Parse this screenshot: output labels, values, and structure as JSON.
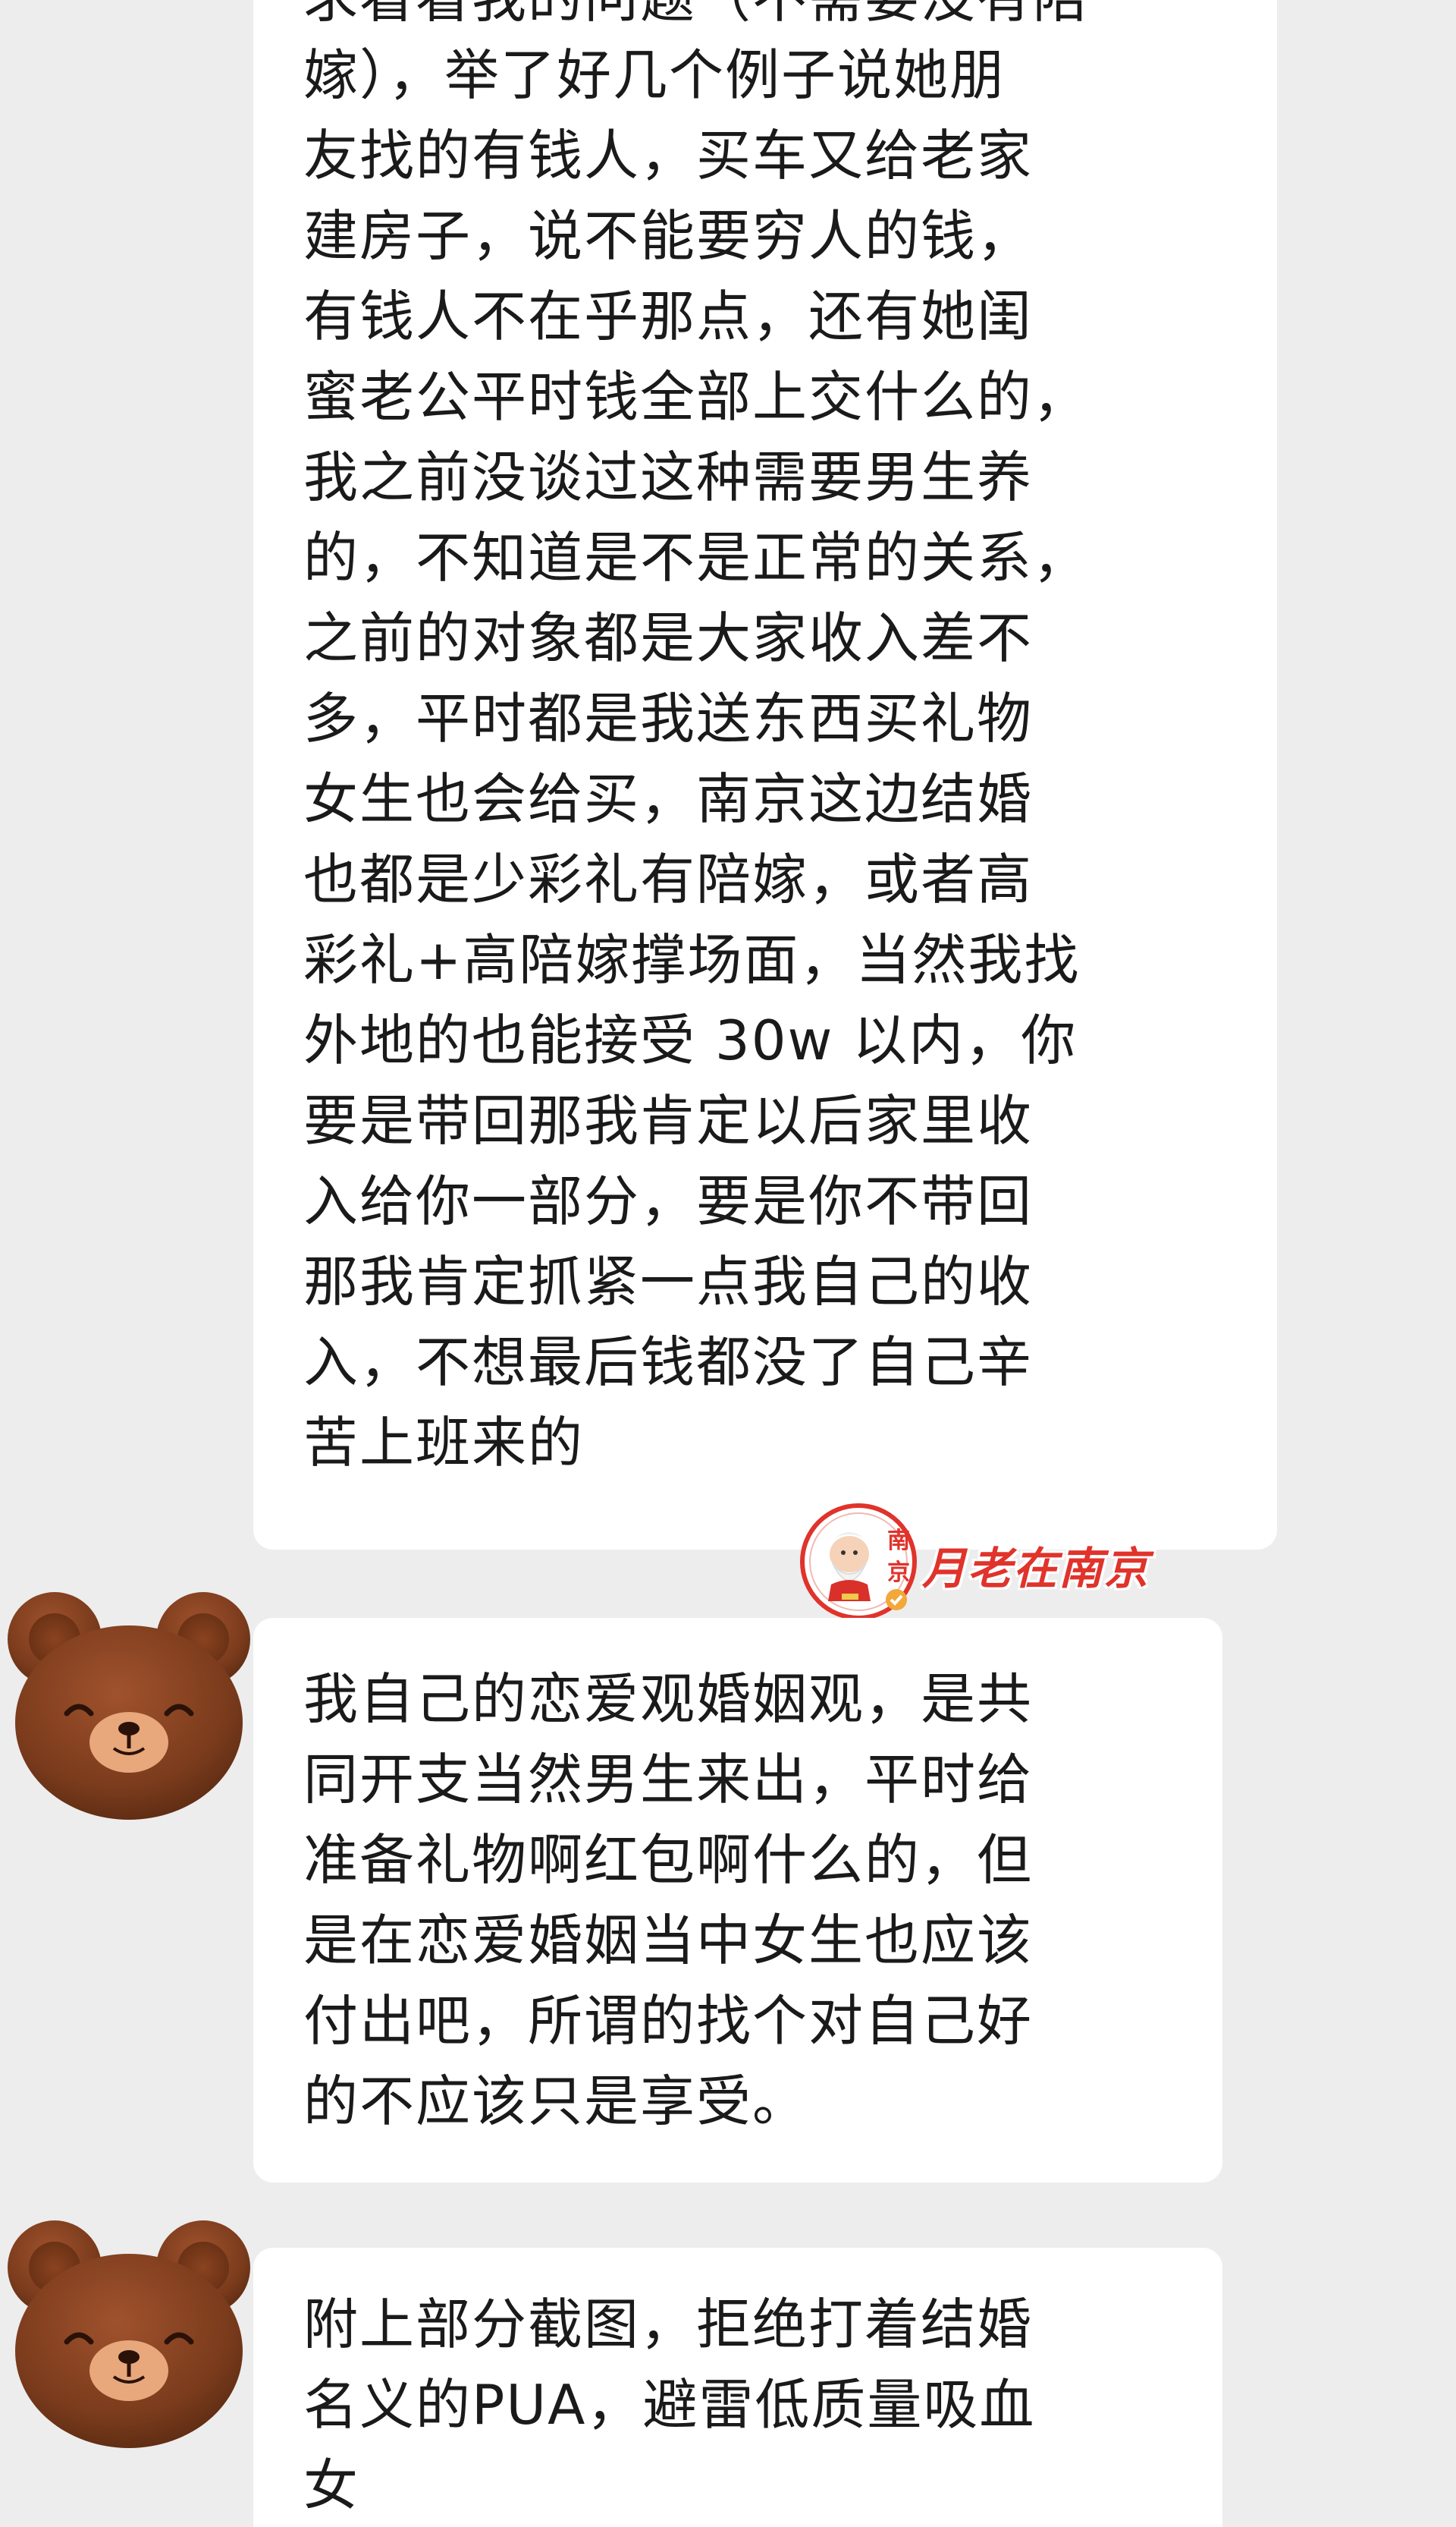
{
  "messages": [
    {
      "partial_top_line": "求看看我的问题（不需要没有陪",
      "lines": [
        "嫁），举了好几个例子说她朋",
        "友找的有钱人，买车又给老家",
        "建房子，说不能要穷人的钱，",
        "有钱人不在乎那点，还有她闺",
        "蜜老公平时钱全部上交什么的，",
        "我之前没谈过这种需要男生养",
        "的，不知道是不是正常的关系，",
        "之前的对象都是大家收入差不",
        "多，平时都是我送东西买礼物",
        "女生也会给买，南京这边结婚",
        "也都是少彩礼有陪嫁，或者高",
        "彩礼+高陪嫁撑场面，当然我找",
        "外地的也能接受 30w 以内，你",
        "要是带回那我肯定以后家里收",
        "入给你一部分，要是你不带回",
        "那我肯定抓紧一点我自己的收",
        "入，不想最后钱都没了自己辛",
        "苦上班来的"
      ]
    },
    {
      "lines": [
        "我自己的恋爱观婚姻观，是共",
        "同开支当然男生来出，平时给",
        "准备礼物啊红包啊什么的，但",
        "是在恋爱婚姻当中女生也应该",
        "付出吧，所谓的找个对自己好",
        "的不应该只是享受。"
      ]
    },
    {
      "lines": [
        "附上部分截图，拒绝打着结婚",
        "名义的PUA，避雷低质量吸血",
        "女"
      ]
    }
  ],
  "watermark": {
    "text": "月老在南京",
    "seal_chars": "南京"
  },
  "colors": {
    "background": "#ededed",
    "bubble": "#ffffff",
    "text": "#1a1a1a",
    "watermark": "#e0332b",
    "avatar_fur": "#7a3b1c",
    "avatar_muzzle": "#e8a87c"
  }
}
